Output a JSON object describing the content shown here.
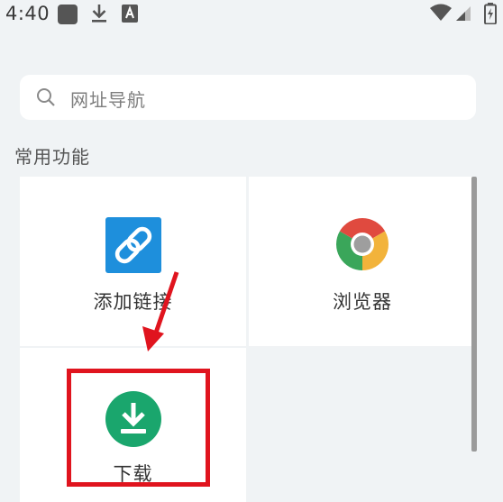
{
  "status_bar": {
    "time": "4:40",
    "icons": [
      "square-icon",
      "download-icon",
      "a-icon",
      "wifi-icon",
      "signal-icon",
      "battery-icon"
    ]
  },
  "search": {
    "placeholder": "网址导航",
    "icon": "search-icon"
  },
  "section": {
    "title": "常用功能"
  },
  "tiles": [
    {
      "label": "添加链接",
      "icon": "link-icon",
      "color": "#1e8fdc"
    },
    {
      "label": "浏览器",
      "icon": "browser-icon",
      "colors": [
        "#e04a3f",
        "#3aa65a",
        "#f2b33b",
        "#9e9e9e"
      ]
    },
    {
      "label": "下载",
      "icon": "download-circle-icon",
      "color": "#1aa66d"
    }
  ],
  "annotation": {
    "highlight_color": "#e0141e",
    "target": "下载"
  }
}
